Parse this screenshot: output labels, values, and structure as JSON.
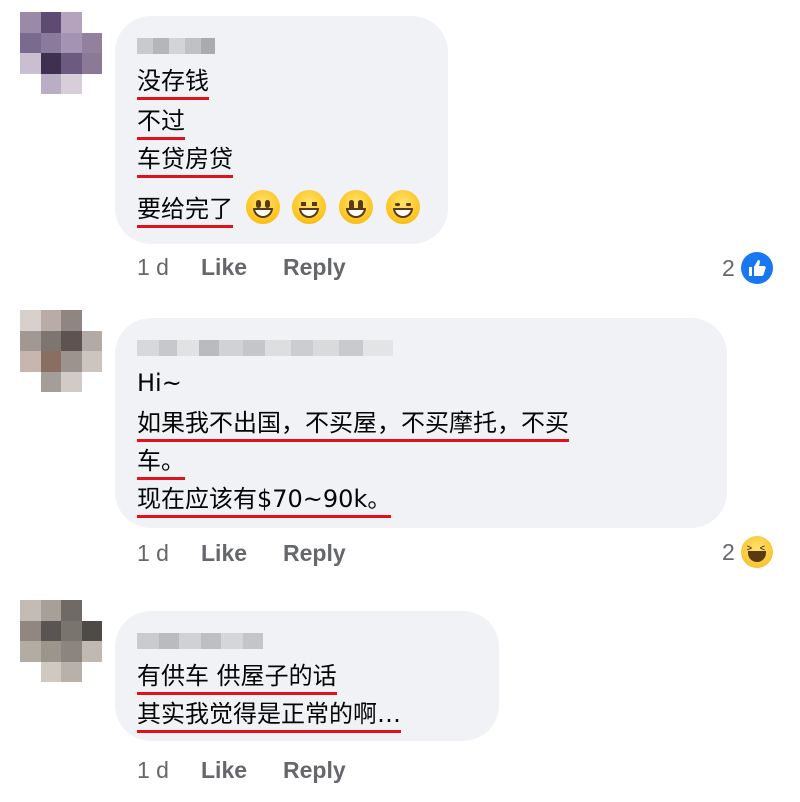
{
  "comments": [
    {
      "lines": [
        "没存钱",
        "不过",
        "车贷房贷",
        "要给完了"
      ],
      "emojis": [
        "grinning-face-icon",
        "beaming-face-icon",
        "grinning-face-big-eyes-icon",
        "grinning-face-smiling-eyes-icon"
      ],
      "time": "1 d",
      "like_label": "Like",
      "reply_label": "Reply",
      "reaction_count": "2",
      "reaction_type": "like-reaction-icon"
    },
    {
      "lines": [
        "Hi~",
        "如果我不出国，不买屋，不买摩托，不买",
        "车。",
        "现在应该有$70~90k。"
      ],
      "time": "1 d",
      "like_label": "Like",
      "reply_label": "Reply",
      "reaction_count": "2",
      "reaction_type": "haha-reaction-icon"
    },
    {
      "lines": [
        "有供车 供屋子的话",
        "其实我觉得是正常的啊…"
      ],
      "time": "1 d",
      "like_label": "Like",
      "reply_label": "Reply"
    }
  ],
  "colors": {
    "bubble": "#f0f2f5",
    "underline": "#e0131d",
    "meta_text": "#65676b",
    "like_blue": "#1877f2"
  }
}
